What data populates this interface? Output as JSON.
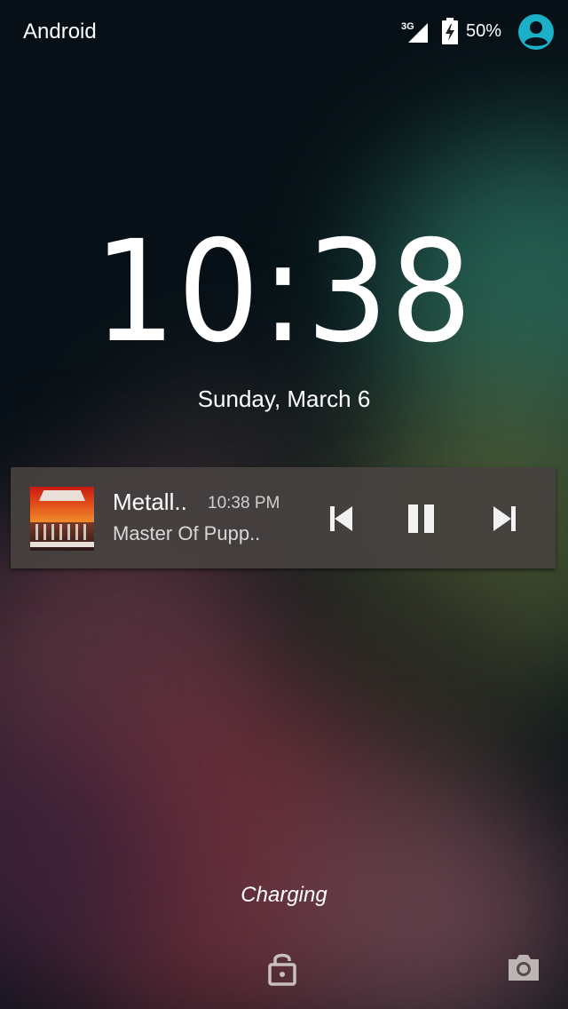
{
  "status_bar": {
    "carrier": "Android",
    "network_type": "3G",
    "battery_percent": "50%",
    "signal_icon": "cell-signal-icon",
    "battery_icon": "battery-charging-icon",
    "user_icon": "account-circle-icon",
    "accent_color": "#1ab0c8"
  },
  "lockscreen": {
    "time": "10:38",
    "date": "Sunday, March 6",
    "charging_text": "Charging"
  },
  "media_notification": {
    "title": "Metall..",
    "time": "10:38 PM",
    "album": "Master Of Pupp..",
    "controls": {
      "previous_icon": "skip-previous-icon",
      "pause_icon": "pause-icon",
      "next_icon": "skip-next-icon"
    }
  },
  "bottom_bar": {
    "unlock_icon": "lock-open-icon",
    "camera_icon": "camera-icon"
  }
}
